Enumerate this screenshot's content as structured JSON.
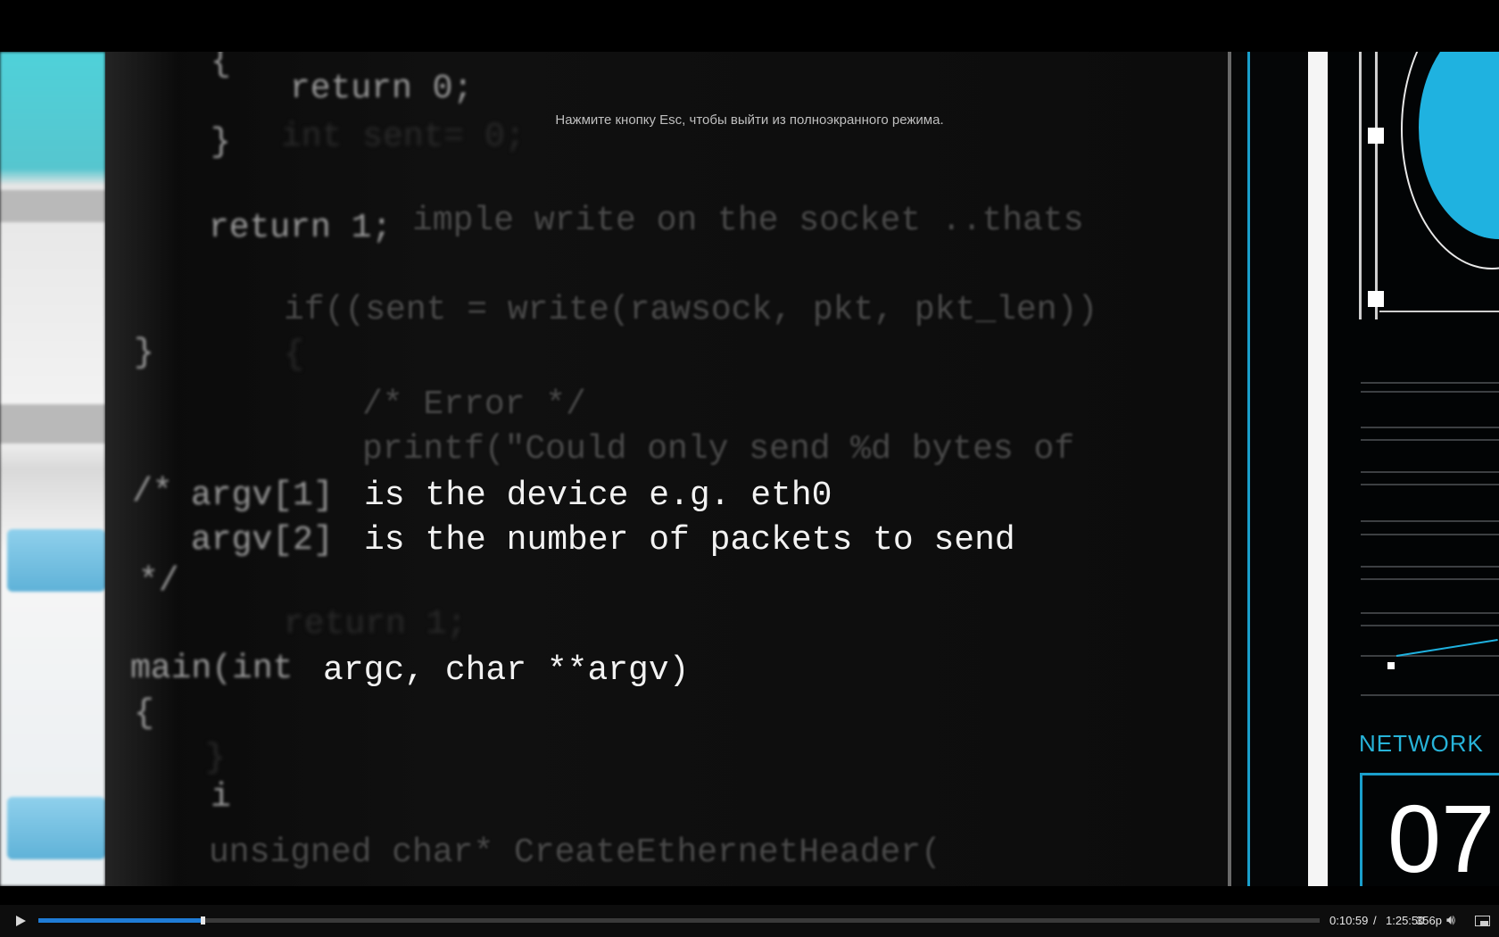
{
  "overlay": {
    "esc_hint": "Нажмите кнопку Esc, чтобы выйти из полноэкранного режима."
  },
  "video": {
    "code_lines": {
      "return0": "return 0;",
      "brace_close1": "}",
      "brace_open_top": "{",
      "int_sent": "int sent= 0;",
      "return1": "return 1;",
      "simple_write": "imple write on the socket ..thats",
      "if_write": "if((sent = write(rawsock, pkt, pkt_len))",
      "brace_open2": "{",
      "brace_close2": "}",
      "error_comment": "/* Error */",
      "printf": "printf(\"Could only send %d bytes of",
      "comment_open": "/*",
      "argv1_name": "argv[1]",
      "argv1_text": "is the device e.g. eth0",
      "argv2_name": "argv[2]",
      "argv2_text": "is the number of packets to send",
      "comment_close": "*/",
      "return1_faint": "return 1;",
      "main_prefix": "main(int",
      "main_rest": "argc, char **argv)",
      "brace_open3": "{",
      "brace_close3": "}",
      "i_line": "i",
      "unsigned_line": "unsigned char* CreateEthernetHeader("
    },
    "hud": {
      "label": "NETWORK",
      "number": "07"
    }
  },
  "controls": {
    "progress_fraction": 0.128,
    "current_time": "0:10:59",
    "separator": "/",
    "total_time": "1:25:50",
    "quality": "356p",
    "accent_color": "#1f7cd6"
  },
  "icons": {
    "play": "play-icon",
    "volume": "volume-icon",
    "fullscreen": "fullscreen-exit-icon"
  }
}
